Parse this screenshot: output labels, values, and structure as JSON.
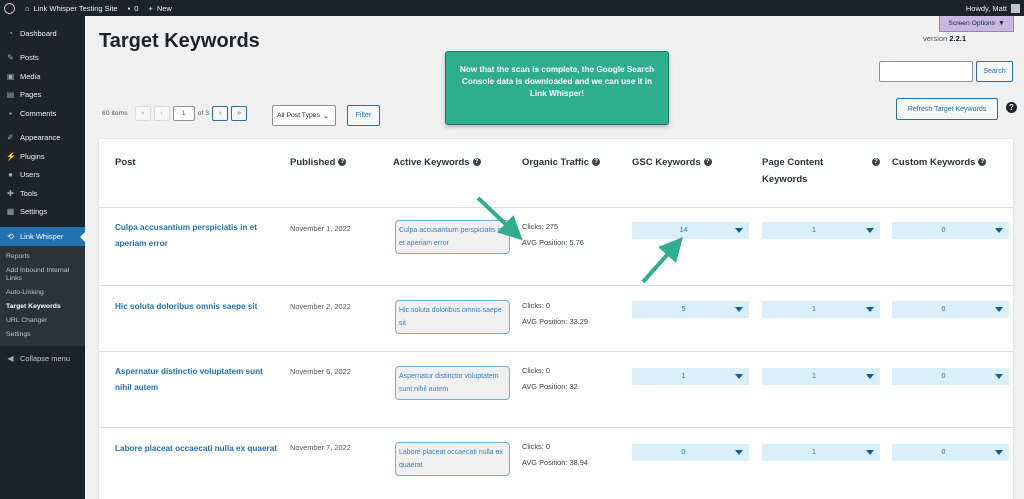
{
  "admin_bar": {
    "site_name": "Link Whisper Testing Site",
    "comments_count": "0",
    "new_label": "New",
    "greeting": "Howdy, Matt"
  },
  "sidebar": {
    "items": [
      {
        "label": "Dashboard",
        "icon": "dashboard-icon"
      },
      {
        "label": "Posts",
        "icon": "pin-icon"
      },
      {
        "label": "Media",
        "icon": "media-icon"
      },
      {
        "label": "Pages",
        "icon": "page-icon"
      },
      {
        "label": "Comments",
        "icon": "comment-icon"
      },
      {
        "label": "Appearance",
        "icon": "brush-icon"
      },
      {
        "label": "Plugins",
        "icon": "plugin-icon"
      },
      {
        "label": "Users",
        "icon": "users-icon"
      },
      {
        "label": "Tools",
        "icon": "wrench-icon"
      },
      {
        "label": "Settings",
        "icon": "settings-icon"
      },
      {
        "label": "Link Whisper",
        "icon": "link-icon"
      }
    ],
    "submenu": [
      "Reports",
      "Add Inbound Internal Links",
      "Auto-Linking",
      "Target Keywords",
      "URL Changer",
      "Settings"
    ],
    "collapse_label": "Collapse menu"
  },
  "header": {
    "title": "Target Keywords",
    "screen_options": "Screen Options",
    "version_label": "version",
    "version_number": "2.2.1"
  },
  "callout_text": "Now that the scan is complete, the Google Search Console data is downloaded and we can use it in Link Whisper!",
  "search": {
    "button": "Search",
    "value": ""
  },
  "refresh_button": "Refresh Target Keywords",
  "pagination": {
    "items": "60 items",
    "first": "«",
    "prev": "‹",
    "current": "1",
    "of": "of 3",
    "next": "›",
    "last": "»"
  },
  "filter": {
    "select_value": "All Post Types",
    "button": "Filter"
  },
  "table": {
    "headers": [
      "Post",
      "Published",
      "Active Keywords",
      "Organic Traffic",
      "GSC Keywords",
      "Page Content Keywords",
      "Custom Keywords"
    ],
    "rows": [
      {
        "title": "Culpa accusantium perspiciatis in et aperiam error",
        "date": "November 1, 2022",
        "active": "Culpa accusantium perspiciatis in et aperiam error",
        "clicks": "Clicks: 275",
        "avg": "AVG Position: 5.76",
        "gsc": "14",
        "page": "1",
        "custom": "0"
      },
      {
        "title": "Hic soluta doloribus omnis saepe sit",
        "date": "November 2, 2022",
        "active": "Hic soluta doloribus omnis saepe sit",
        "clicks": "Clicks: 0",
        "avg": "AVG Position: 33.29",
        "gsc": "5",
        "page": "1",
        "custom": "0"
      },
      {
        "title": "Aspernatur distinctio voluptatem sunt nihil autem",
        "date": "November 6, 2022",
        "active": "Aspernatur distinctio voluptatem sunt nihil autem",
        "clicks": "Clicks: 0",
        "avg": "AVG Position: 32",
        "gsc": "1",
        "page": "1",
        "custom": "0"
      },
      {
        "title": "Labore placeat occaecati nulla ex quaerat",
        "date": "November 7, 2022",
        "active": "Labore placeat occaecati nulla ex quaerat",
        "clicks": "Clicks: 0",
        "avg": "AVG Position: 38.94",
        "gsc": "0",
        "page": "1",
        "custom": "0"
      }
    ]
  },
  "colors": {
    "accent": "#2271b1",
    "callout": "#2fae8e",
    "sidebar": "#1d2327",
    "dropdown": "#d9f0fb"
  }
}
